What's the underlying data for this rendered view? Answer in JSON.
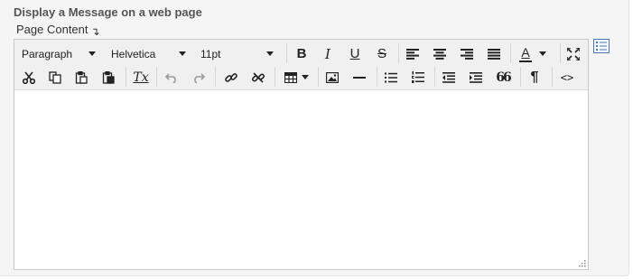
{
  "section": {
    "title": "Display a Message on a web page"
  },
  "field": {
    "label": "Page Content",
    "marker": "↴"
  },
  "toolbar": {
    "format_value": "Paragraph",
    "font_value": "Helvetica",
    "size_value": "11pt",
    "bold": "B",
    "italic": "I",
    "underline": "U",
    "strike": "S",
    "text_color": "A",
    "blockquote": "66",
    "paragraph_mark": "¶",
    "source_code": "<>",
    "clear_format": "Tx"
  },
  "colors": {
    "accent": "#4a78b5",
    "text_color_bar": "#222222"
  }
}
